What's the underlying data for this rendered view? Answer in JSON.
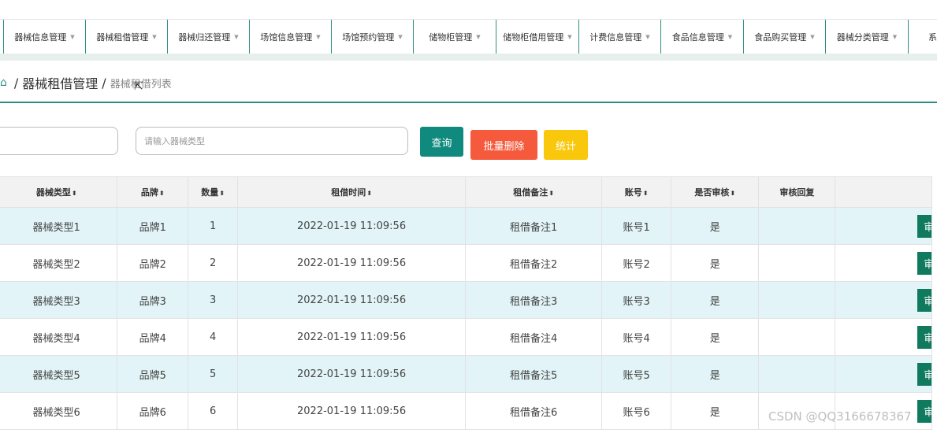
{
  "nav": {
    "items": [
      {
        "label": "器械信息管理"
      },
      {
        "label": "器械租借管理"
      },
      {
        "label": "器械归还管理"
      },
      {
        "label": "场馆信息管理"
      },
      {
        "label": "场馆预约管理"
      },
      {
        "label": "储物柜管理"
      },
      {
        "label": "储物柜借用管理"
      },
      {
        "label": "计费信息管理"
      },
      {
        "label": "食品信息管理"
      },
      {
        "label": "食品购买管理"
      },
      {
        "label": "器械分类管理"
      },
      {
        "label": "系"
      }
    ],
    "caret": "▼"
  },
  "breadcrumb": {
    "section": "器械租借管理",
    "current": "器械租借列表",
    "sep": "/"
  },
  "search": {
    "placeholder": "请输入器械类型",
    "search_label": "查询",
    "batch_delete_label": "批量删除",
    "stats_label": "统计"
  },
  "table": {
    "headers": [
      "器械类型",
      "品牌",
      "数量",
      "租借时间",
      "租借备注",
      "账号",
      "是否审核",
      "审核回复",
      ""
    ],
    "sort_icon": "⬍",
    "rows": [
      {
        "type": "器械类型1",
        "brand": "品牌1",
        "qty": "1",
        "time": "2022-01-19 11:09:56",
        "note": "租借备注1",
        "account": "账号1",
        "audited": "是",
        "reply": ""
      },
      {
        "type": "器械类型2",
        "brand": "品牌2",
        "qty": "2",
        "time": "2022-01-19 11:09:56",
        "note": "租借备注2",
        "account": "账号2",
        "audited": "是",
        "reply": ""
      },
      {
        "type": "器械类型3",
        "brand": "品牌3",
        "qty": "3",
        "time": "2022-01-19 11:09:56",
        "note": "租借备注3",
        "account": "账号3",
        "audited": "是",
        "reply": ""
      },
      {
        "type": "器械类型4",
        "brand": "品牌4",
        "qty": "4",
        "time": "2022-01-19 11:09:56",
        "note": "租借备注4",
        "account": "账号4",
        "audited": "是",
        "reply": ""
      },
      {
        "type": "器械类型5",
        "brand": "品牌5",
        "qty": "5",
        "time": "2022-01-19 11:09:56",
        "note": "租借备注5",
        "account": "账号5",
        "audited": "是",
        "reply": ""
      },
      {
        "type": "器械类型6",
        "brand": "品牌6",
        "qty": "6",
        "time": "2022-01-19 11:09:56",
        "note": "租借备注6",
        "account": "账号6",
        "audited": "是",
        "reply": ""
      }
    ],
    "audit_label": "审"
  },
  "watermark": "CSDN @QQ3166678367",
  "colors": {
    "accent": "#2e8f80",
    "search_btn": "#108a7e",
    "delete_btn": "#f55a3c",
    "stats_btn": "#f9c70b",
    "row_stripe": "#e2f4f7",
    "audit_btn": "#107a5e"
  }
}
